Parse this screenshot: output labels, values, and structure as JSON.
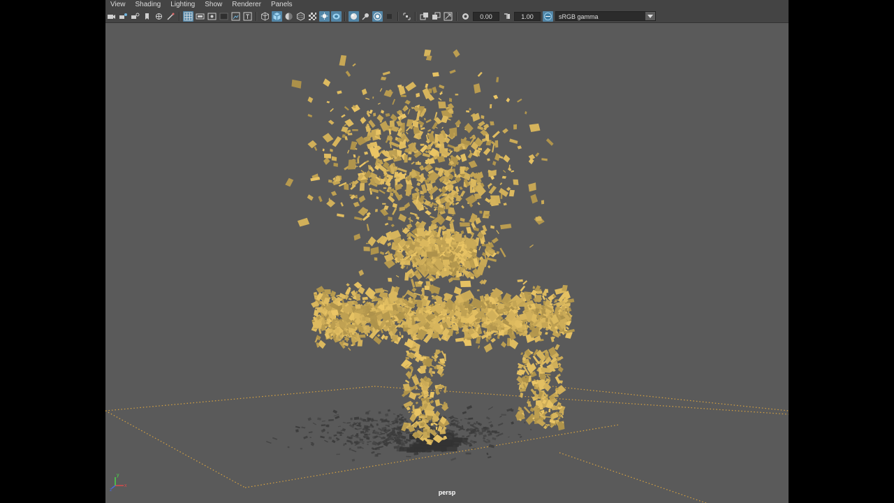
{
  "menu": [
    "View",
    "Shading",
    "Lighting",
    "Show",
    "Renderer",
    "Panels"
  ],
  "toolbar": {
    "exposure": "0.00",
    "gamma": "1.00",
    "color_space": "sRGB gamma"
  },
  "viewport": {
    "camera_label": "persp"
  },
  "axis": {
    "x": "x",
    "y": "y",
    "z": "z"
  },
  "colors": {
    "background": "#5a5a5a",
    "toolbar": "#444444",
    "highlight": "#5285a6",
    "particle": "#d6b45c",
    "grid": "#d9a441",
    "shadow": "#3c3c3c"
  },
  "icons": [
    "camera-icon",
    "camera-attr-icon",
    "bookmark-icon",
    "image-plane-icon",
    "grid-icon",
    "film-gate-icon",
    "resolution-gate-icon",
    "gate-mask-icon",
    "field-chart-icon",
    "safe-action-icon",
    "safe-title-icon",
    "wireframe-icon",
    "smooth-shade-icon",
    "default-material-icon",
    "textured-icon",
    "lights-icon",
    "shadows-icon",
    "screen-ao-icon",
    "motion-blur-icon",
    "anti-alias-icon",
    "depth-of-field-icon",
    "isolate-icon",
    "xray-icon",
    "xray-joints-icon",
    "xray-active-icon",
    "backface-icon",
    "exposure-icon",
    "gamma-icon",
    "color-management-icon"
  ]
}
